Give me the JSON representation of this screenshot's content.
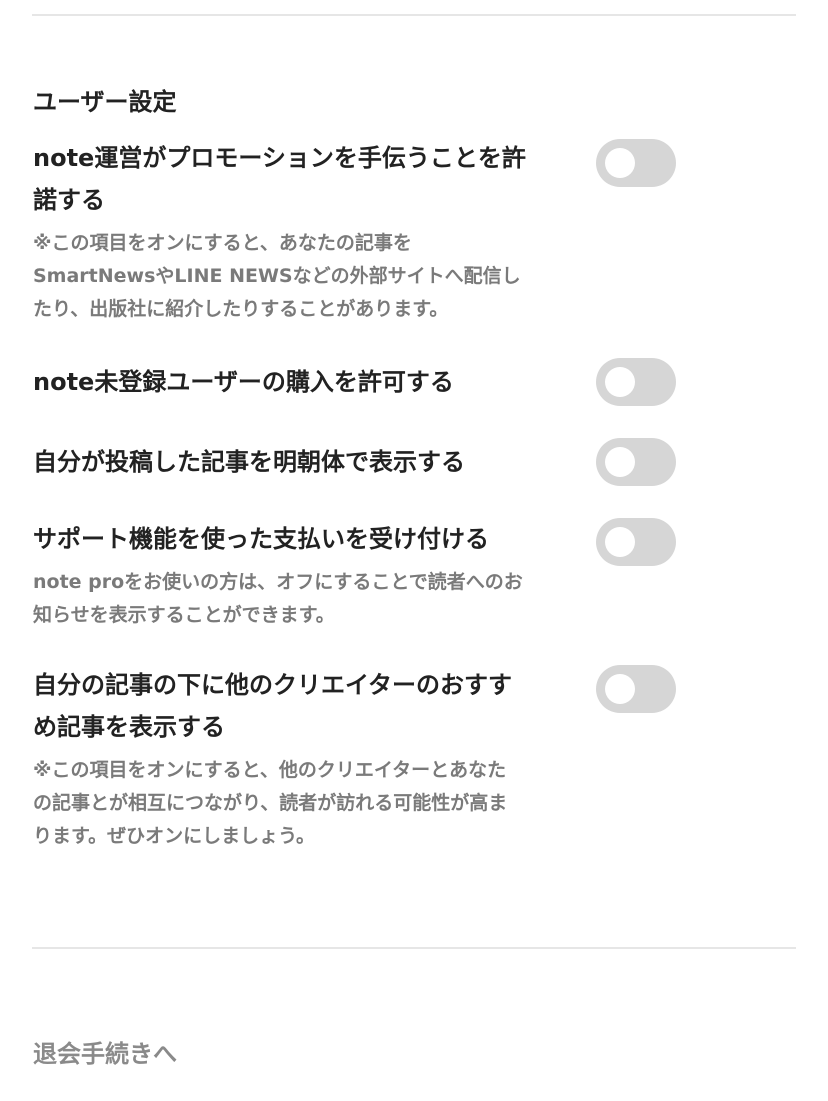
{
  "section": {
    "title": "ユーザー設定"
  },
  "settings": [
    {
      "label_lines": [
        "note運営がプロモーションを手伝うことを許",
        "諾する"
      ],
      "note_lines": [
        "※この項目をオンにすると、あなたの記事を",
        "SmartNewsやLINE NEWSなどの外部サイトへ配信し",
        "たり、出版社に紹介したりすることがあります。"
      ],
      "enabled": false
    },
    {
      "label_lines": [
        "note未登録ユーザーの購入を許可する"
      ],
      "note_lines": [],
      "enabled": false
    },
    {
      "label_lines": [
        "自分が投稿した記事を明朝体で表示する"
      ],
      "note_lines": [],
      "enabled": false
    },
    {
      "label_lines": [
        "サポート機能を使った支払いを受け付ける"
      ],
      "note_lines": [
        "note proをお使いの方は、オフにすることで読者へのお",
        "知らせを表示することができます。"
      ],
      "enabled": false
    },
    {
      "label_lines": [
        "自分の記事の下に他のクリエイターのおすす",
        "め記事を表示する"
      ],
      "note_lines": [
        "※この項目をオンにすると、他のクリエイターとあなた",
        "の記事とが相互につながり、読者が訪れる可能性が高ま",
        "ります。ぜひオンにしましょう。"
      ],
      "enabled": false
    }
  ],
  "footer": {
    "withdraw_label": "退会手続きへ"
  },
  "colors": {
    "toggle_off": "#d6d6d6",
    "text_primary": "#222222",
    "text_muted": "#7a7a7a",
    "divider": "#e6e6e6"
  }
}
